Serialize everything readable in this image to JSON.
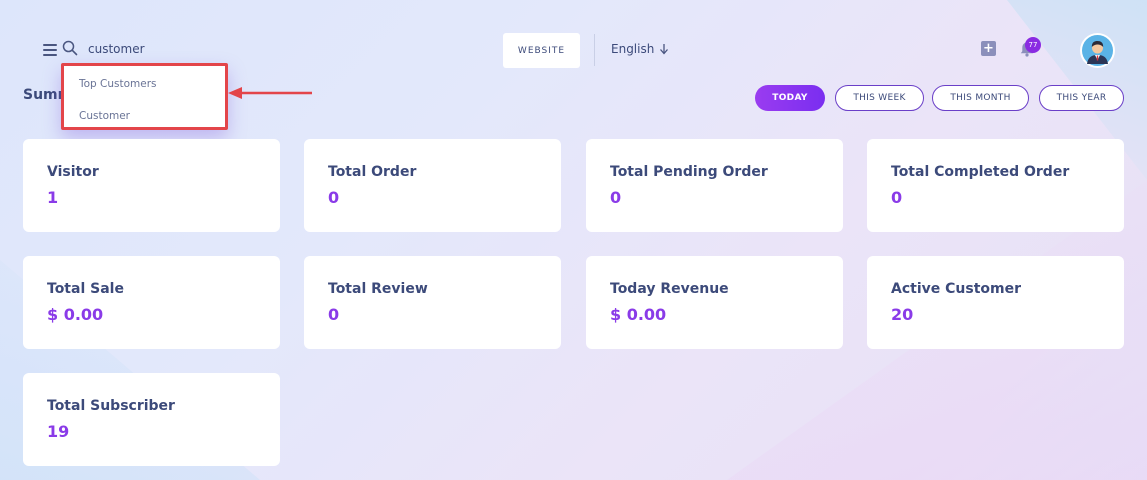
{
  "header": {
    "search_value": "customer",
    "website_label": "WEBSITE",
    "language": "English",
    "notification_count": "77"
  },
  "page": {
    "title": "Summ"
  },
  "search_dropdown": {
    "items": [
      "Top Customers",
      "Customer"
    ]
  },
  "periods": {
    "today": "TODAY",
    "week": "THIS WEEK",
    "month": "THIS MONTH",
    "year": "THIS YEAR",
    "active": "TODAY"
  },
  "cards": [
    {
      "label": "Visitor",
      "value": "1"
    },
    {
      "label": "Total Order",
      "value": "0"
    },
    {
      "label": "Total Pending Order",
      "value": "0"
    },
    {
      "label": "Total Completed Order",
      "value": "0"
    },
    {
      "label": "Total Sale",
      "value": "$ 0.00"
    },
    {
      "label": "Total Review",
      "value": "0"
    },
    {
      "label": "Today Revenue",
      "value": "$ 0.00"
    },
    {
      "label": "Active Customer",
      "value": "20"
    },
    {
      "label": "Total Subscriber",
      "value": "19"
    }
  ],
  "colors": {
    "accent": "#8a3be8",
    "annotation": "#e3454a"
  },
  "icons": {
    "menu": "menu-icon",
    "search": "search-icon",
    "language": "arrow-down-icon",
    "add": "plus-square-icon",
    "notifications": "bell-icon",
    "user": "avatar-icon"
  }
}
